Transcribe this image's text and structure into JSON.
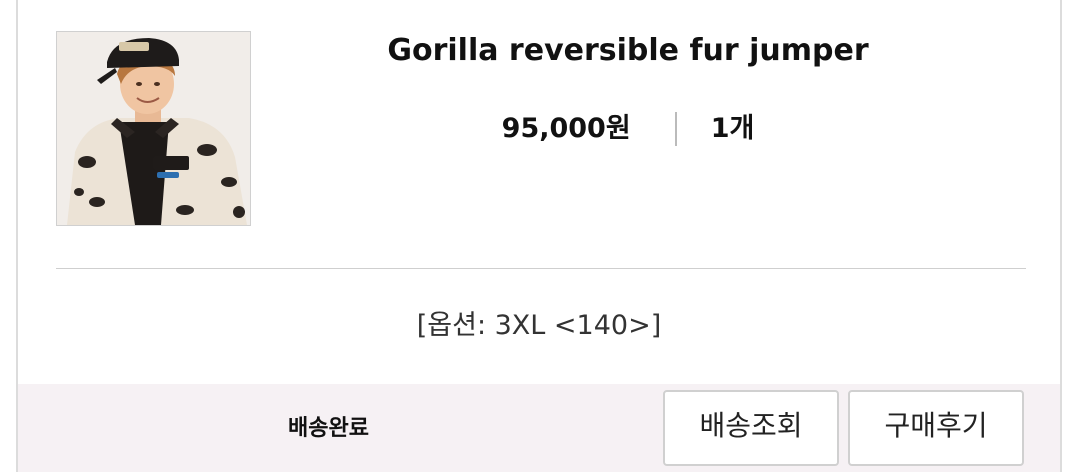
{
  "product": {
    "name": "Gorilla reversible fur jumper",
    "price": "95,000원",
    "quantity": "1개",
    "option": "[옵션: 3XL <140>]",
    "thumbnail_icon": "product-photo-kid-jumper"
  },
  "order": {
    "status": "배송완료",
    "track_button_label": "배송조회",
    "review_button_label": "구매후기"
  },
  "colors": {
    "footer_background": "#f6f1f4",
    "border": "#dcdcdc",
    "text": "#111111"
  }
}
